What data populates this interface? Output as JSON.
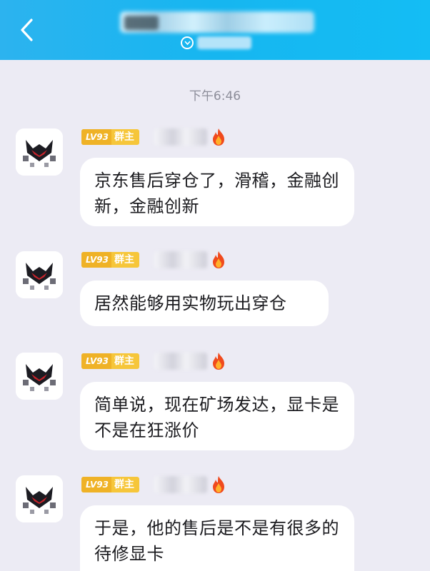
{
  "header": {
    "back_icon": "chevron-left-icon",
    "title_obscured": true,
    "status_icon": "chevron-down-circle-icon",
    "accent_color": "#1cb6f0"
  },
  "chat": {
    "timestamp": "下午6:46",
    "messages": [
      {
        "level": "LV93",
        "role": "群主",
        "nickname_obscured": true,
        "flame_icon": "flame-icon",
        "text": "京东售后穿仓了，滑稽，金融创新，金融创新"
      },
      {
        "level": "LV93",
        "role": "群主",
        "nickname_obscured": true,
        "flame_icon": "flame-icon",
        "text": "居然能够用实物玩出穿仓"
      },
      {
        "level": "LV93",
        "role": "群主",
        "nickname_obscured": true,
        "flame_icon": "flame-icon",
        "text": "简单说，现在矿场发达，显卡是不是在狂涨价"
      },
      {
        "level": "LV93",
        "role": "群主",
        "nickname_obscured": true,
        "flame_icon": "flame-icon",
        "text": "于是，他的售后是不是有很多的待修显卡"
      }
    ]
  }
}
